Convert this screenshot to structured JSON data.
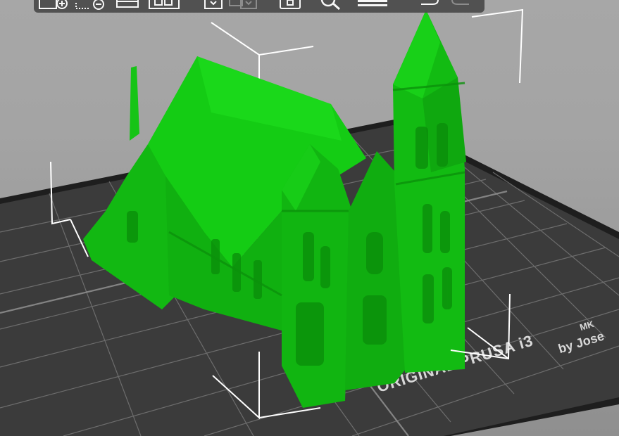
{
  "bed_label": {
    "brand": "ORIGINAL PRUSA i3",
    "model": "MK",
    "designer": "by Jose"
  },
  "colors": {
    "background": "#a5a5a5",
    "bed_top": "#3a3a3a",
    "bed_edge": "#1f1f1f",
    "bed_grid": "#7a7a7a",
    "model": "#12c812",
    "model_shadow": "#0a8f0a",
    "bounding_box": "#ffffff",
    "toolbar": "#4a4a4a",
    "toolbar_icon": "#ffffff",
    "toolbar_icon_disabled": "#8a8a8a"
  },
  "toolbar": {
    "buttons": [
      {
        "name": "add-button",
        "icon": "add-icon"
      },
      {
        "name": "delete-button",
        "icon": "delete-icon"
      },
      {
        "name": "delete-all-button",
        "icon": "delete-all-icon"
      },
      {
        "name": "arrange-button",
        "icon": "arrange-icon"
      },
      {
        "name": "copy-button",
        "icon": "copy-icon"
      },
      {
        "name": "paste-button",
        "icon": "paste-icon"
      },
      {
        "name": "add-instance-button",
        "icon": "add-instance-icon"
      },
      {
        "name": "remove-instance-button",
        "icon": "remove-instance-icon"
      },
      {
        "name": "split-objects-button",
        "icon": "split-objects-icon"
      },
      {
        "name": "search-button",
        "icon": "search-icon"
      },
      {
        "name": "layers-editing-button",
        "icon": "layers-icon"
      },
      {
        "name": "undo-button",
        "icon": "undo-icon"
      },
      {
        "name": "redo-button",
        "icon": "redo-icon"
      }
    ]
  }
}
